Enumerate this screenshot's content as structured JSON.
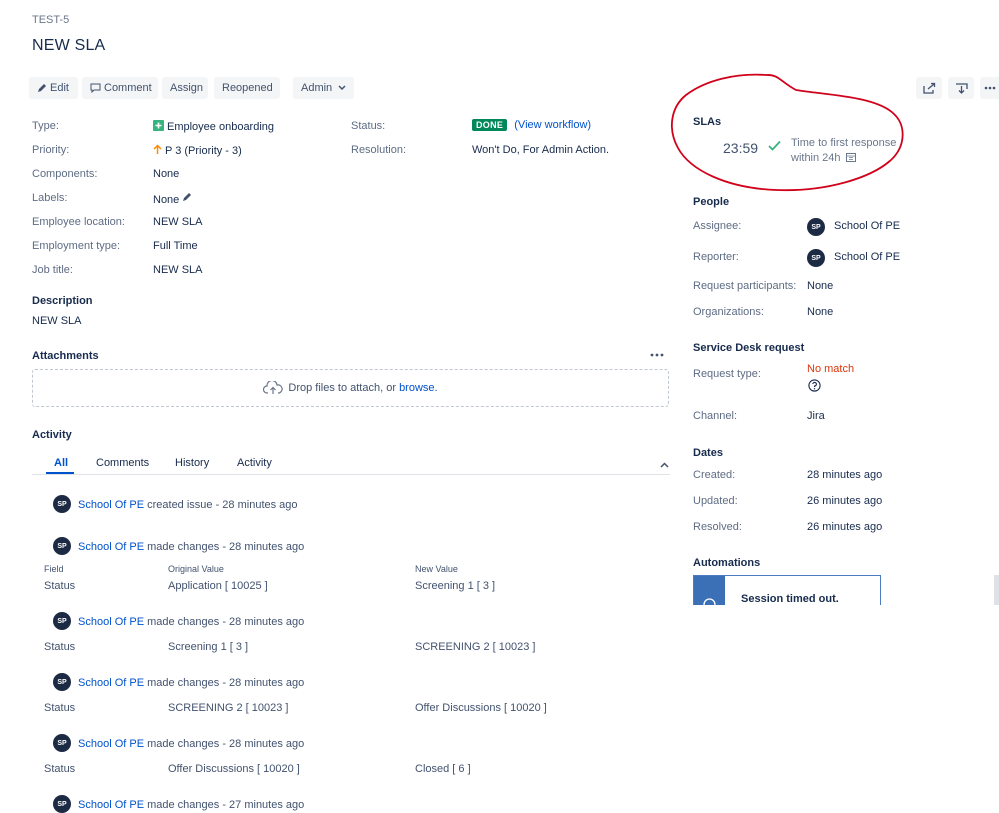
{
  "issue": {
    "key": "TEST-5",
    "title": "NEW SLA"
  },
  "toolbar": {
    "edit": "Edit",
    "comment": "Comment",
    "assign": "Assign",
    "reopened": "Reopened",
    "admin": "Admin"
  },
  "details": {
    "type": {
      "label": "Type:",
      "value": "Employee onboarding"
    },
    "priority": {
      "label": "Priority:",
      "value": "P 3 (Priority - 3)"
    },
    "components": {
      "label": "Components:",
      "value": "None"
    },
    "labels": {
      "label": "Labels:",
      "value": "None"
    },
    "employee_location": {
      "label": "Employee location:",
      "value": "NEW SLA"
    },
    "employment_type": {
      "label": "Employment type:",
      "value": "Full Time"
    },
    "job_title": {
      "label": "Job title:",
      "value": "NEW SLA"
    },
    "status": {
      "label": "Status:",
      "badge": "DONE",
      "workflow_link": "(View workflow)"
    },
    "resolution": {
      "label": "Resolution:",
      "value": "Won't Do, For Admin Action."
    }
  },
  "description": {
    "heading": "Description",
    "text": "NEW SLA"
  },
  "attachments": {
    "heading": "Attachments",
    "drop_text": "Drop files to attach, or",
    "browse": "browse."
  },
  "activity": {
    "heading": "Activity",
    "tabs": [
      "All",
      "Comments",
      "History",
      "Activity"
    ],
    "entries": [
      {
        "user": "School Of PE",
        "action": "created issue - 28 minutes ago"
      },
      {
        "user": "School Of PE",
        "action": "made changes - 28 minutes ago",
        "headers": {
          "field": "Field",
          "original": "Original Value",
          "new": "New Value"
        },
        "field": "Status",
        "original": "Application [ 10025 ]",
        "new": "Screening 1 [ 3 ]"
      },
      {
        "user": "School Of PE",
        "action": "made changes - 28 minutes ago",
        "field": "Status",
        "original": "Screening 1 [ 3 ]",
        "new": "SCREENING 2 [ 10023 ]"
      },
      {
        "user": "School Of PE",
        "action": "made changes - 28 minutes ago",
        "field": "Status",
        "original": "SCREENING 2 [ 10023 ]",
        "new": "Offer Discussions [ 10020 ]"
      },
      {
        "user": "School Of PE",
        "action": "made changes - 28 minutes ago",
        "field": "Status",
        "original": "Offer Discussions [ 10020 ]",
        "new": "Closed [ 6 ]"
      },
      {
        "user": "School Of PE",
        "action": "made changes - 27 minutes ago"
      }
    ],
    "avatar_initials": "SP"
  },
  "slas": {
    "heading": "SLAs",
    "time": "23:59",
    "goal": "Time to first response",
    "within": "within 24h"
  },
  "people": {
    "heading": "People",
    "assignee": {
      "label": "Assignee:",
      "value": "School Of PE"
    },
    "reporter": {
      "label": "Reporter:",
      "value": "School Of PE"
    },
    "participants": {
      "label": "Request participants:",
      "value": "None"
    },
    "organizations": {
      "label": "Organizations:",
      "value": "None"
    },
    "avatar_initials": "SP"
  },
  "service_desk": {
    "heading": "Service Desk request",
    "request_type": {
      "label": "Request type:",
      "value": "No match"
    },
    "channel": {
      "label": "Channel:",
      "value": "Jira"
    }
  },
  "dates": {
    "heading": "Dates",
    "created": {
      "label": "Created:",
      "value": "28 minutes ago"
    },
    "updated": {
      "label": "Updated:",
      "value": "26 minutes ago"
    },
    "resolved": {
      "label": "Resolved:",
      "value": "26 minutes ago"
    }
  },
  "automations": {
    "heading": "Automations",
    "session_message": "Session timed out."
  },
  "colors": {
    "link": "#0052cc",
    "done": "#00875a",
    "no_match": "#de350b",
    "annotation": "#d0021b",
    "avatar": "#1d2a44"
  }
}
